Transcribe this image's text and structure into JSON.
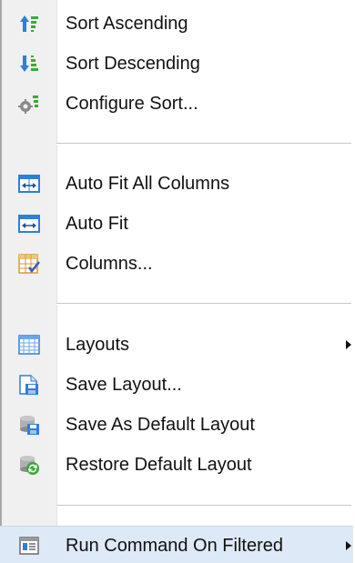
{
  "menu": {
    "items": [
      {
        "label": "Sort Ascending",
        "icon": "sort-ascending-icon"
      },
      {
        "label": "Sort Descending",
        "icon": "sort-descending-icon"
      },
      {
        "label": "Configure Sort...",
        "icon": "configure-sort-icon"
      },
      {
        "label": "Auto Fit All Columns",
        "icon": "auto-fit-all-icon"
      },
      {
        "label": "Auto Fit",
        "icon": "auto-fit-icon"
      },
      {
        "label": "Columns...",
        "icon": "columns-icon"
      },
      {
        "label": "Layouts",
        "icon": "layouts-icon",
        "submenu": true
      },
      {
        "label": "Save Layout...",
        "icon": "save-layout-icon"
      },
      {
        "label": "Save As Default Layout",
        "icon": "save-default-layout-icon"
      },
      {
        "label": "Restore Default Layout",
        "icon": "restore-layout-icon"
      },
      {
        "label": "Run Command On Filtered",
        "icon": "run-command-icon",
        "submenu": true,
        "highlighted": true
      }
    ]
  },
  "colors": {
    "gutter": "#f0f0f0",
    "highlight": "#dde9f6",
    "separator": "#c8c8c8",
    "accent_blue": "#2f7fd8",
    "accent_green": "#3aa83a"
  }
}
